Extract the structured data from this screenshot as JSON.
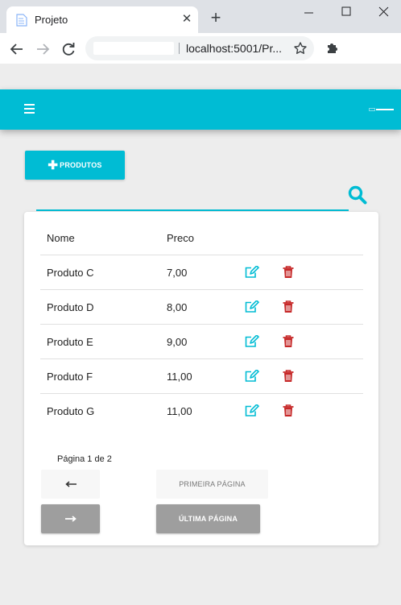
{
  "browser": {
    "tab_title": "Projeto",
    "tab_close": "✕",
    "new_tab": "+",
    "url": "localhost:5001/Pr..."
  },
  "app": {
    "accent": "#00bcd4",
    "add_button_label": "PRODUTOS",
    "table": {
      "headers": {
        "name": "Nome",
        "price": "Preco"
      },
      "rows": [
        {
          "name": "Produto C",
          "price": "7,00"
        },
        {
          "name": "Produto D",
          "price": "8,00"
        },
        {
          "name": "Produto E",
          "price": "9,00"
        },
        {
          "name": "Produto F",
          "price": "11,00"
        },
        {
          "name": "Produto G",
          "price": "11,00"
        }
      ]
    },
    "pagination": {
      "page_info": "Página 1 de 2",
      "first_label": "PRIMEIRA PÁGINA",
      "last_label": "ÚLTIMA PÁGINA"
    },
    "icons": {
      "edit": "pencil-square-icon",
      "delete": "trash-icon",
      "search": "search-icon",
      "menu": "hamburger-icon"
    },
    "colors": {
      "edit": "#00bcd4",
      "delete": "#c62828"
    }
  }
}
